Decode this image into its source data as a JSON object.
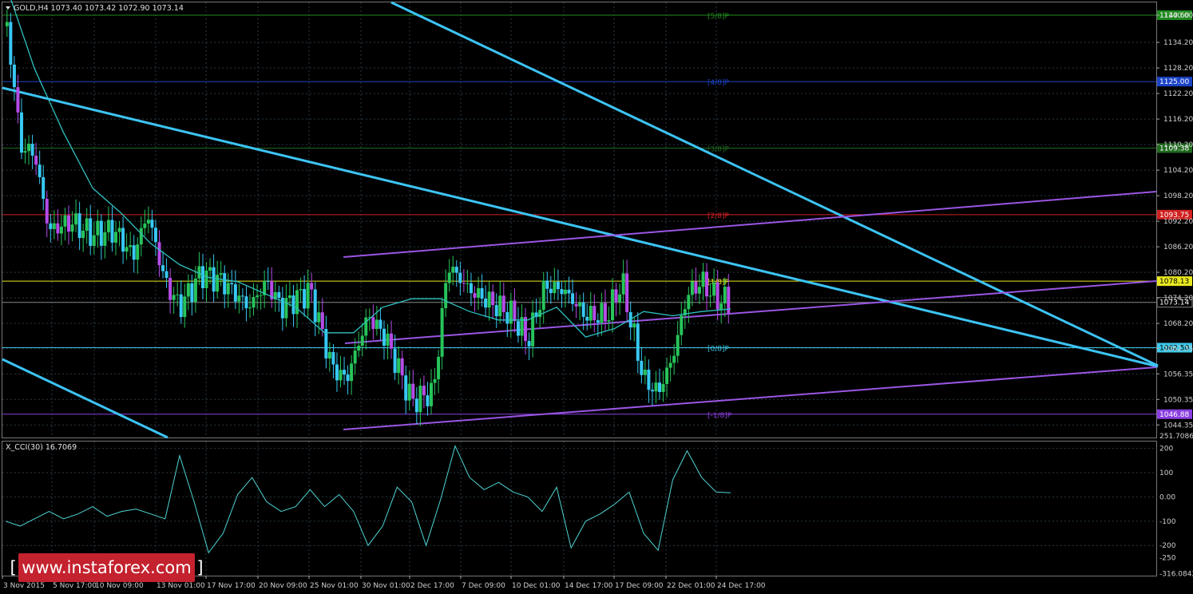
{
  "header": {
    "symbol_label": "GOLD,H4  1073.40 1073.42 1072.90 1073.14"
  },
  "indicator": {
    "label": "X_CCI(30) 16.7069"
  },
  "watermark": {
    "text": "[ www.instaforex.com ]"
  },
  "colors": {
    "background": "#000000",
    "grid": "#2a3a46",
    "bull_candle": "#27c45a",
    "bear_candle": "#38c8f4",
    "bear_candle_alt": "#b44ce8",
    "moving_average": "#2ec0c0",
    "channel_blue": "#3cc4f4",
    "channel_purple": "#9a56e4",
    "cci_line": "#4fd4d4",
    "watermark_bg": "#c4222e"
  },
  "chart_data": [
    {
      "type": "candlestick",
      "title": "GOLD,H4",
      "ohlc_current": {
        "open": 1073.4,
        "high": 1073.42,
        "low": 1072.9,
        "close": 1073.14
      },
      "ylim": [
        1041.4,
        1143.6
      ],
      "y_ticks": [
        "1140.60",
        "1134.20",
        "1128.20",
        "1122.20",
        "1116.20",
        "1110.20",
        "1104.20",
        "1098.20",
        "1092.20",
        "1086.20",
        "1080.20",
        "1074.20",
        "1068.20",
        "1062.35",
        "1056.35",
        "1050.35",
        "1044.35"
      ],
      "x_ticks": [
        "3 Nov 2015",
        "5 Nov 17:00",
        "10 Nov 09:00",
        "13 Nov 01:00",
        "17 Nov 17:00",
        "20 Nov 09:00",
        "25 Nov 01:00",
        "30 Nov 01:00",
        "2 Dec 17:00",
        "7 Dec 09:00",
        "10 Dec 01:00",
        "14 Dec 17:00",
        "17 Dec 09:00",
        "22 Dec 01:00",
        "24 Dec 17:00"
      ],
      "murrey_levels": [
        {
          "label": "[5/8]P",
          "price": 1140.6,
          "color": "#1f8a1f",
          "price_label": "1140.60"
        },
        {
          "label": "[4/8]P",
          "price": 1125.0,
          "color": "#1c44c8",
          "price_label": "1125.00"
        },
        {
          "label": "[3/8]P",
          "price": 1109.38,
          "color": "#1f6a1f",
          "price_label": "1109.38"
        },
        {
          "label": "[2/8]P",
          "price": 1093.75,
          "color": "#d02020",
          "price_label": "1093.75"
        },
        {
          "label": "[1/8]P",
          "price": 1078.13,
          "color": "#e8e820",
          "price_label": "1078.13"
        },
        {
          "label": "[0/8]P",
          "price": 1062.5,
          "color": "#3cc8e8",
          "price_label": "1062.50"
        },
        {
          "label": "[-1/8]P",
          "price": 1046.88,
          "color": "#8a3ee0",
          "price_label": "1046.88"
        }
      ],
      "last_price": {
        "value": 1073.14,
        "label": "1073.14"
      },
      "sma_points": [
        [
          0,
          1148
        ],
        [
          20,
          1128
        ],
        [
          40,
          1113
        ],
        [
          60,
          1100
        ],
        [
          80,
          1094
        ],
        [
          100,
          1087
        ],
        [
          120,
          1082
        ],
        [
          140,
          1079
        ],
        [
          160,
          1078
        ],
        [
          180,
          1075
        ],
        [
          200,
          1072
        ],
        [
          220,
          1066
        ],
        [
          240,
          1066
        ],
        [
          260,
          1072
        ],
        [
          280,
          1074
        ],
        [
          300,
          1074
        ],
        [
          320,
          1071
        ],
        [
          340,
          1069
        ],
        [
          360,
          1069
        ],
        [
          380,
          1072
        ],
        [
          400,
          1065
        ],
        [
          420,
          1067
        ],
        [
          440,
          1071
        ],
        [
          460,
          1070
        ],
        [
          480,
          1071
        ],
        [
          500,
          1071.6
        ]
      ],
      "cci": {
        "name": "X_CCI(30)",
        "value": 16.7069,
        "ylim": [
          -321,
          225
        ],
        "y_ticks": [
          "251.7086",
          "200",
          "100",
          "0.00",
          "-100",
          "-200",
          "-250",
          "-316.0842"
        ],
        "points": [
          [
            0,
            -100
          ],
          [
            10,
            -120
          ],
          [
            20,
            -90
          ],
          [
            30,
            -60
          ],
          [
            40,
            -90
          ],
          [
            50,
            -70
          ],
          [
            60,
            -40
          ],
          [
            70,
            -80
          ],
          [
            80,
            -60
          ],
          [
            90,
            -50
          ],
          [
            100,
            -70
          ],
          [
            110,
            -90
          ],
          [
            120,
            170
          ],
          [
            130,
            -20
          ],
          [
            140,
            -230
          ],
          [
            150,
            -150
          ],
          [
            160,
            10
          ],
          [
            170,
            80
          ],
          [
            180,
            -20
          ],
          [
            190,
            -60
          ],
          [
            200,
            -40
          ],
          [
            210,
            30
          ],
          [
            220,
            -40
          ],
          [
            230,
            10
          ],
          [
            240,
            -60
          ],
          [
            250,
            -200
          ],
          [
            260,
            -120
          ],
          [
            270,
            40
          ],
          [
            280,
            -20
          ],
          [
            290,
            -200
          ],
          [
            300,
            -10
          ],
          [
            310,
            210
          ],
          [
            320,
            80
          ],
          [
            330,
            30
          ],
          [
            340,
            60
          ],
          [
            350,
            20
          ],
          [
            360,
            0
          ],
          [
            370,
            -60
          ],
          [
            380,
            40
          ],
          [
            390,
            -210
          ],
          [
            400,
            -100
          ],
          [
            410,
            -70
          ],
          [
            420,
            -30
          ],
          [
            430,
            20
          ],
          [
            440,
            -150
          ],
          [
            450,
            -220
          ],
          [
            460,
            70
          ],
          [
            470,
            190
          ],
          [
            480,
            80
          ],
          [
            490,
            20
          ],
          [
            500,
            17
          ]
        ]
      }
    }
  ]
}
